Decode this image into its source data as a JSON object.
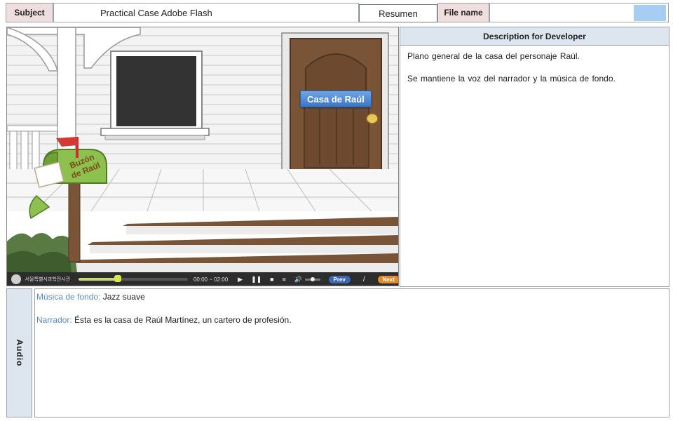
{
  "header": {
    "subject_label": "Subject",
    "subject_value": "Practical Case Adobe Flash",
    "resumen": "Resumen",
    "file_name_label": "File name",
    "file_name_value": ""
  },
  "scene": {
    "door_label": "Casa de Raúl",
    "mailbox_label_line1": "Buzón",
    "mailbox_label_line2": "de Raúl"
  },
  "player": {
    "logo_text": "서울특별시과학전시관",
    "time": "00:00 ~ 02:00",
    "progress": 0.35,
    "volume": 0.5,
    "prev_label": "Prev",
    "separator": "/",
    "next_label": "Next"
  },
  "description": {
    "title": "Description for Developer",
    "lines": [
      "Plano general de la casa del personaje Raúl.",
      "Se mantiene la voz del narrador y la música de fondo."
    ]
  },
  "audio": {
    "side_label": "Audio",
    "lines": [
      {
        "key": "Música de fondo:",
        "value": "Jazz suave"
      },
      {
        "key": "Narrador:",
        "value": "Ésta es la casa de Raúl Martínez, un cartero de profesión."
      }
    ]
  },
  "colors": {
    "label_bg": "#f0dede",
    "panel_bg": "#dde5ee",
    "accent_blue": "#a8cdf3",
    "door": "#7a5436",
    "prev": "#3a68b4",
    "next": "#e08a2a"
  }
}
